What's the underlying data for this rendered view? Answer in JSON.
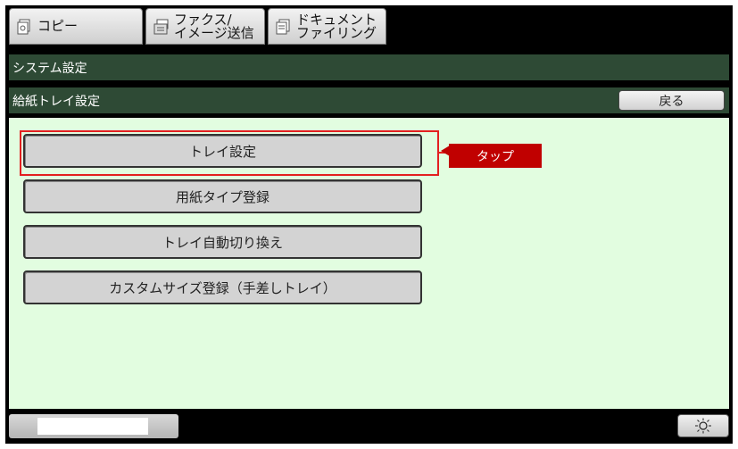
{
  "tabs": [
    {
      "label": "コピー",
      "icon": "copy-icon"
    },
    {
      "label": "ファクス/\nイメージ送信",
      "icon": "fax-icon"
    },
    {
      "label": "ドキュメント\nファイリング",
      "icon": "document-filing-icon"
    }
  ],
  "header": {
    "system_title": "システム設定",
    "section_title": "給紙トレイ設定",
    "back_label": "戻る"
  },
  "menu": [
    {
      "label": "トレイ設定"
    },
    {
      "label": "用紙タイプ登録"
    },
    {
      "label": "トレイ自動切り換え"
    },
    {
      "label": "カスタムサイズ登録（手差しトレイ）"
    }
  ],
  "annotation": {
    "label": "タップ",
    "color": "#c00000"
  },
  "footer": {
    "brightness_icon": "brightness-icon"
  },
  "colors": {
    "header_bg": "#2e4a35",
    "content_bg": "#e2fde0",
    "highlight": "#e32020"
  }
}
